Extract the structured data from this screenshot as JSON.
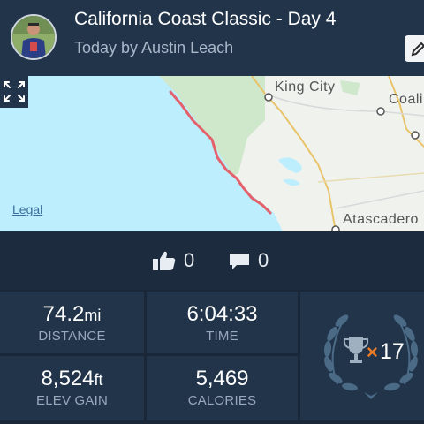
{
  "activity": {
    "title": "California Coast Classic - Day 4",
    "subtitle": "Today by Austin Leach"
  },
  "map": {
    "labels": [
      "King City",
      "Coali",
      "Atascadero"
    ],
    "legal_link": "Legal"
  },
  "social": {
    "kudos_count": "0",
    "comment_count": "0"
  },
  "stats": {
    "distance": {
      "value": "74.2",
      "unit": "mi",
      "label": "DISTANCE"
    },
    "time": {
      "value": "6:04:33",
      "label": "TIME"
    },
    "elevation": {
      "value": "8,524",
      "unit": "ft",
      "label": "ELEV GAIN"
    },
    "calories": {
      "value": "5,469",
      "label": "CALORIES"
    }
  },
  "achievements": {
    "multiplier": "×",
    "count": "17"
  },
  "colors": {
    "header_bg": "#22344a",
    "route": "#e4606a",
    "water": "#bdeefd",
    "accent_orange": "#f07b22"
  },
  "icons": [
    "avatar",
    "edit-icon",
    "expand-icon",
    "thumbs-up-icon",
    "comment-icon",
    "trophy-icon",
    "laurel-wreath-icon"
  ]
}
